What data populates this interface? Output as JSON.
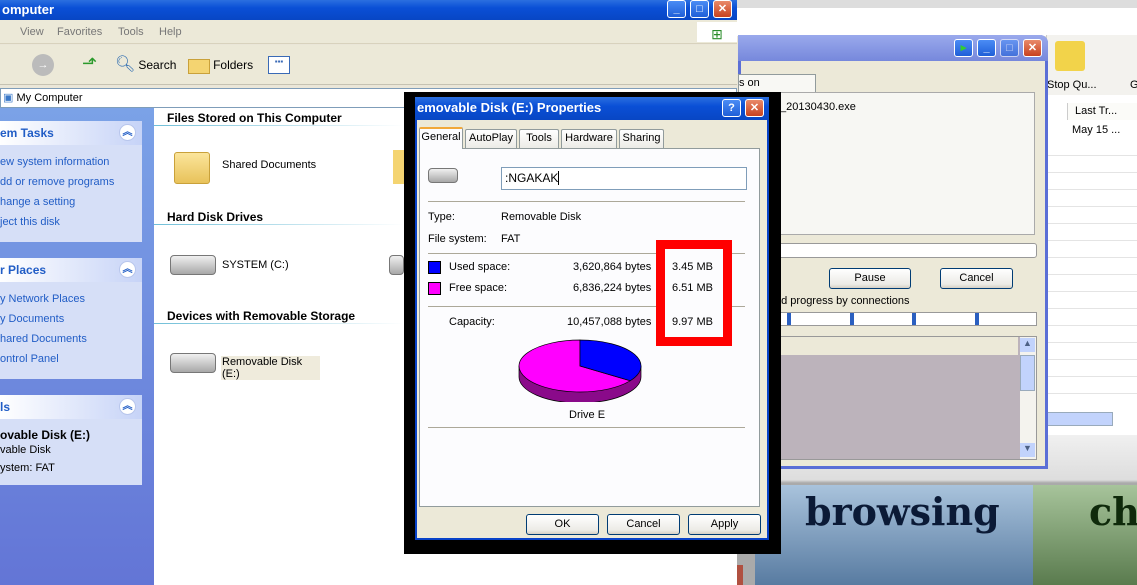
{
  "explorer": {
    "title": "omputer",
    "menu": [
      "View",
      "Favorites",
      "Tools",
      "Help"
    ],
    "toolbar": {
      "search": "Search",
      "folders": "Folders"
    },
    "address": "My Computer",
    "system_tasks": {
      "title": "em Tasks",
      "items": [
        "ew system information",
        "dd or remove programs",
        "hange a setting",
        "ject this disk"
      ]
    },
    "other_places": {
      "title": "r Places",
      "items": [
        "y Network Places",
        "y Documents",
        "hared Documents",
        "ontrol Panel"
      ]
    },
    "details": {
      "title": "ls",
      "name": "ovable Disk (E:)",
      "type": "vable Disk",
      "fs": "ystem: FAT"
    },
    "sections": {
      "files": {
        "title": "Files Stored on This Computer",
        "items": [
          "Shared Documents"
        ]
      },
      "hdd": {
        "title": "Hard Disk Drives",
        "items": [
          "SYSTEM (C:)"
        ]
      },
      "removable": {
        "title": "Devices with Removable Storage",
        "items": [
          "Removable Disk (E:)"
        ]
      }
    }
  },
  "properties": {
    "title": "emovable Disk (E:) Properties",
    "tabs": [
      "General",
      "AutoPlay",
      "Tools",
      "Hardware",
      "Sharing"
    ],
    "active_tab": "General",
    "label_value": ":NGAKAK",
    "type_label": "Type:",
    "type_value": "Removable Disk",
    "fs_label": "File system:",
    "fs_value": "FAT",
    "used_label": "Used space:",
    "used_bytes": "3,620,864 bytes",
    "used_mb": "3.45 MB",
    "free_label": "Free space:",
    "free_bytes": "6,836,224 bytes",
    "free_mb": "6.51 MB",
    "capacity_label": "Capacity:",
    "capacity_bytes": "10,457,088 bytes",
    "capacity_mb": "9.97 MB",
    "used_fraction": 0.346,
    "used_color": "#0000ff",
    "free_color": "#ff00ff",
    "highlight_color": "#ff0000",
    "drive_caption": "Drive E",
    "buttons": {
      "ok": "OK",
      "cancel": "Cancel",
      "apply": "Apply"
    }
  },
  "download": {
    "tab": "s on completion",
    "file": "_20130430.exe",
    "pause": "Pause",
    "cancel": "Cancel",
    "progress_label": "ad progress by connections"
  },
  "manager": {
    "toolbar": [
      "Stop Qu...",
      "G"
    ],
    "column": "Last Tr...",
    "cell": "May 15 ..."
  },
  "banner": {
    "words": [
      "browsing",
      "ch"
    ]
  }
}
